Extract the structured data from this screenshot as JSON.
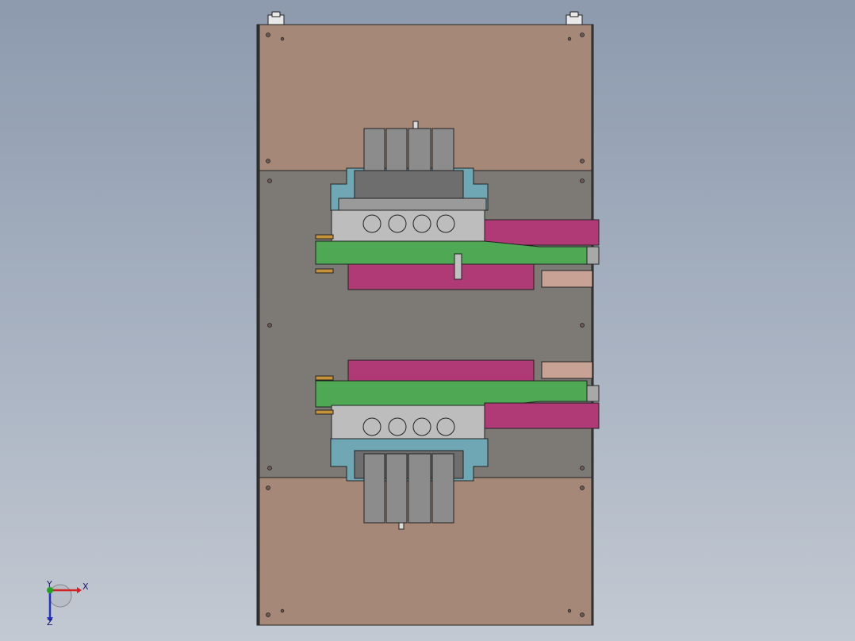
{
  "view": {
    "background_top": "#8d9aae",
    "background_bottom": "#c3c9d2"
  },
  "colors": {
    "plate_copper": "#a58878",
    "plate_gray": "#7d7a76",
    "block_gray": "#8c8c8c",
    "light_gray": "#bdbdbd",
    "magenta": "#b03a76",
    "green": "#4fa854",
    "teal": "#6fa8b4",
    "orange": "#c8923a",
    "edge": "#222222"
  },
  "triad": {
    "x_label": "X",
    "y_label": "Y",
    "z_label": "Z",
    "x_color": "#d42020",
    "y_color": "#21a021",
    "z_color": "#2530c8"
  }
}
